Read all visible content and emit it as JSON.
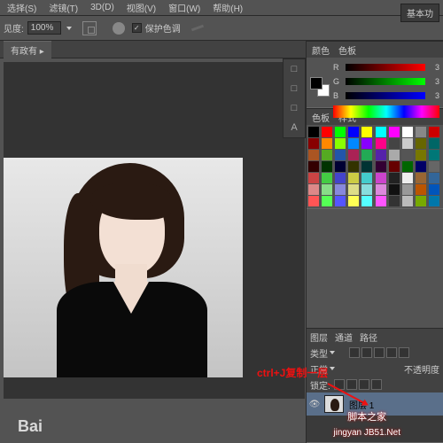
{
  "menu": {
    "items": [
      "选择(S)",
      "滤镜(T)",
      "3D(D)",
      "视图(V)",
      "窗口(W)",
      "帮助(H)"
    ]
  },
  "options": {
    "zoom_label": "见度:",
    "zoom_value": "100%",
    "protect_label": "保护色调",
    "mode_btn": "基本功"
  },
  "tabs": {
    "doc": "有政有 ▸"
  },
  "panels": {
    "color": {
      "title": "颜色",
      "tab2": "色板",
      "r": "R",
      "g": "G",
      "b": "B",
      "rv": "3",
      "gv": "3",
      "bv": "3"
    },
    "swatches": {
      "title": "色板",
      "tab2": "样式"
    },
    "layers": {
      "title": "图层",
      "tab2": "通道",
      "tab3": "路径",
      "kind": "类型",
      "opacity": "不透明度",
      "opacity_val": "",
      "lock": "锁定:",
      "layer1": "图层 1"
    }
  },
  "tools": [
    "□",
    "□",
    "□",
    "A"
  ],
  "annotation": "ctrl+J复制一层",
  "watermark": {
    "baidu": "Bai",
    "site_cn": "脚本之家",
    "site_en": "jingyan JB51.Net"
  },
  "swatches": [
    "#000",
    "#f00",
    "#0f0",
    "#00f",
    "#ff0",
    "#0ff",
    "#f0f",
    "#fff",
    "#888",
    "#c00",
    "#800",
    "#f80",
    "#8f0",
    "#08f",
    "#80f",
    "#f08",
    "#444",
    "#ccc",
    "#660",
    "#066",
    "#a52",
    "#5a2",
    "#25a",
    "#a25",
    "#2a5",
    "#52a",
    "#aaa",
    "#555",
    "#770",
    "#077",
    "#300",
    "#030",
    "#003",
    "#330",
    "#033",
    "#303",
    "#600",
    "#060",
    "#006",
    "#666",
    "#c44",
    "#4c4",
    "#44c",
    "#cc4",
    "#4cc",
    "#c4c",
    "#222",
    "#eee",
    "#963",
    "#369",
    "#d88",
    "#8d8",
    "#88d",
    "#dd8",
    "#8dd",
    "#d8d",
    "#111",
    "#999",
    "#b50",
    "#05b",
    "#f55",
    "#5f5",
    "#55f",
    "#ff5",
    "#5ff",
    "#f5f",
    "#333",
    "#bbb",
    "#7a0",
    "#07a"
  ]
}
